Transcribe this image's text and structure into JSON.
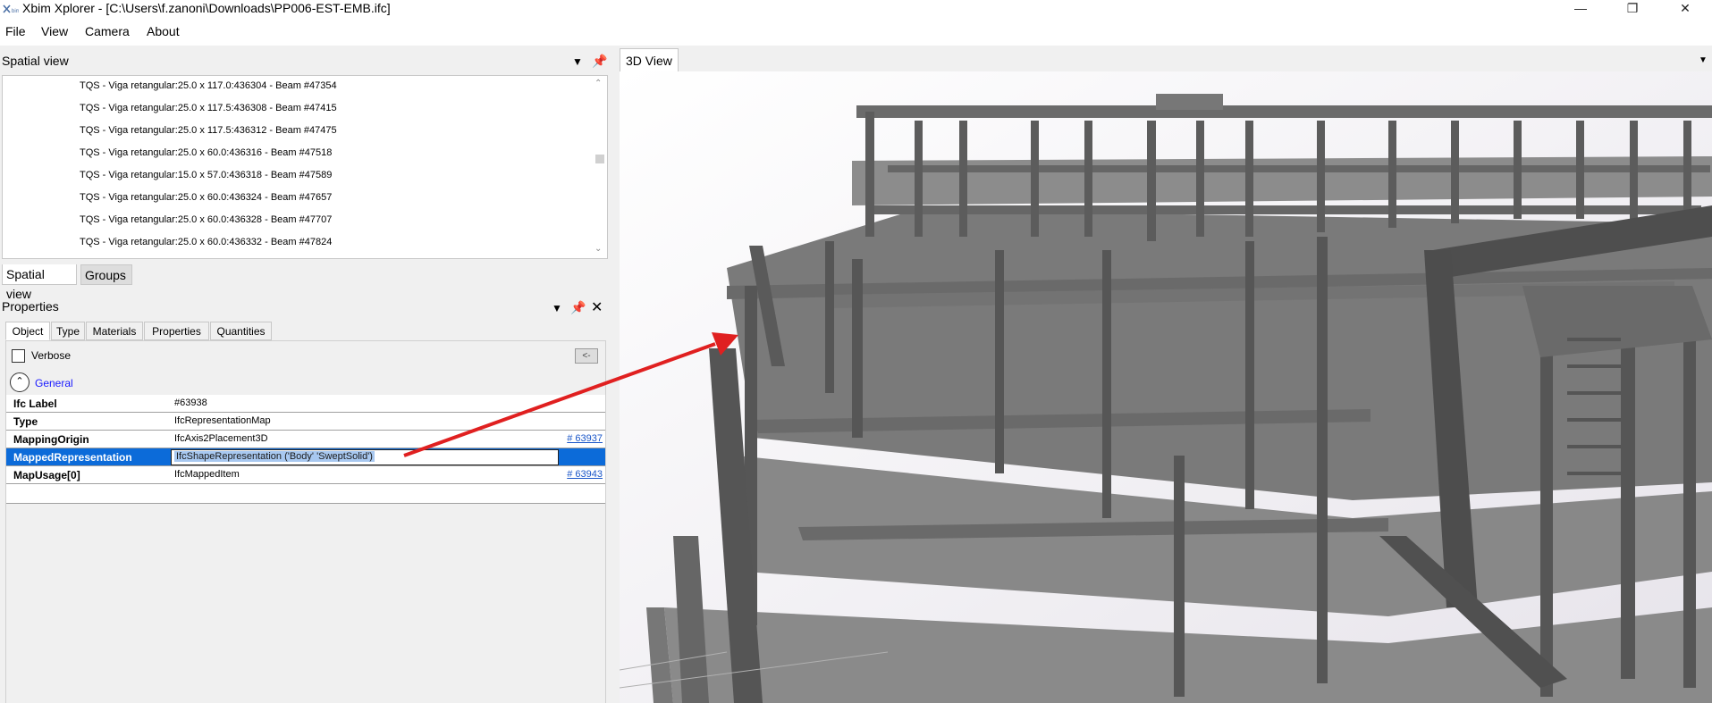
{
  "window": {
    "title": "Xbim Xplorer - [C:\\Users\\f.zanoni\\Downloads\\PP006-EST-EMB.ifc]",
    "app_icon": "xbim-logo-icon",
    "minimize_icon": "minimize-icon",
    "restore_icon": "restore-icon",
    "close_icon": "close-icon"
  },
  "menu": [
    "File",
    "View",
    "Camera",
    "About"
  ],
  "spatial_view": {
    "title": "Spatial view",
    "items": [
      "TQS - Viga retangular:25.0 x 117.0:436304 - Beam #47354",
      "TQS - Viga retangular:25.0 x 117.5:436308 - Beam #47415",
      "TQS - Viga retangular:25.0 x 117.5:436312 - Beam #47475",
      "TQS - Viga retangular:25.0 x 60.0:436316 - Beam #47518",
      "TQS - Viga retangular:15.0 x 57.0:436318 - Beam #47589",
      "TQS - Viga retangular:25.0 x 60.0:436324 - Beam #47657",
      "TQS - Viga retangular:25.0 x 60.0:436328 - Beam #47707",
      "TQS - Viga retangular:25.0 x 60.0:436332 - Beam #47824"
    ],
    "tabs": [
      "Spatial view",
      "Groups"
    ]
  },
  "properties": {
    "title": "Properties",
    "tabs": [
      "Object",
      "Type",
      "Materials",
      "Properties",
      "Quantities"
    ],
    "verbose_label": "Verbose",
    "back_label": "<-",
    "group_label": "General",
    "rows": [
      {
        "name": "Ifc Label",
        "value": "#63938",
        "link": ""
      },
      {
        "name": "Type",
        "value": "IfcRepresentationMap",
        "link": ""
      },
      {
        "name": "MappingOrigin",
        "value": "IfcAxis2Placement3D",
        "link": "# 63937"
      },
      {
        "name": "MappedRepresentation",
        "value": "IfcShapeRepresentation ('Body' 'SweptSolid')",
        "link": ""
      },
      {
        "name": "MapUsage[0]",
        "value": "IfcMappedItem",
        "link": "# 63943"
      }
    ]
  },
  "view3d": {
    "title": "3D View",
    "annotation_color": "#e02020",
    "model_color": "#6e6e6e"
  }
}
